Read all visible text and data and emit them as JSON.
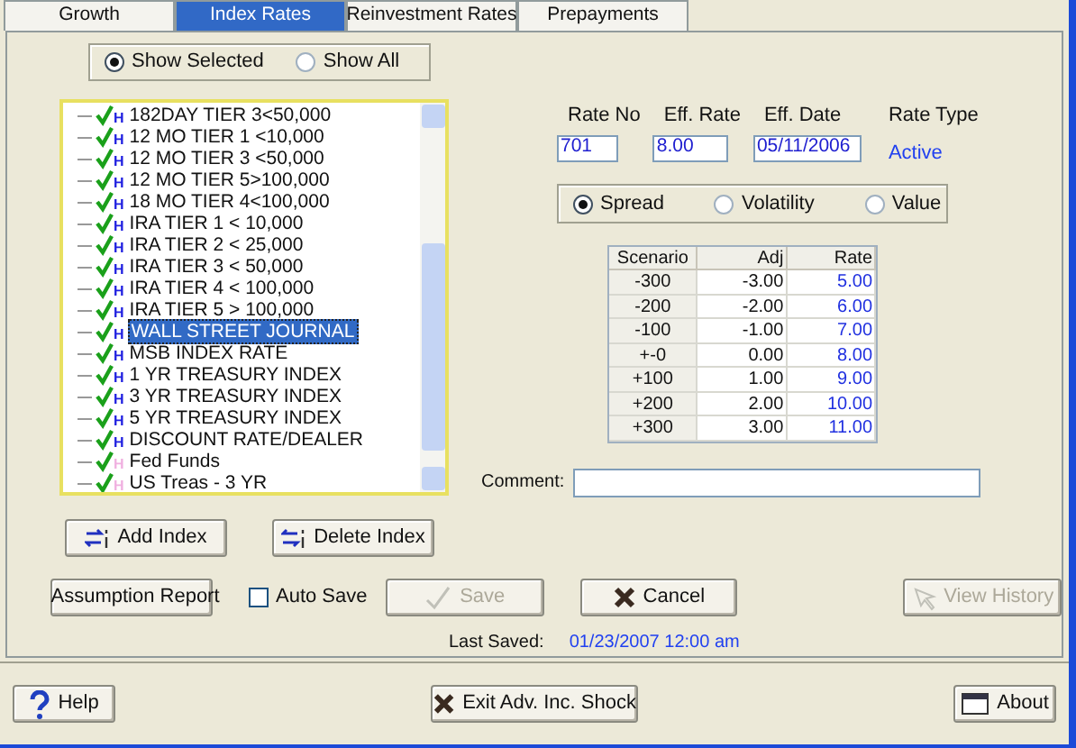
{
  "tabs": [
    {
      "label": "Growth",
      "selected": false
    },
    {
      "label": "Index Rates",
      "selected": true
    },
    {
      "label": "Reinvestment Rates",
      "selected": false
    },
    {
      "label": "Prepayments",
      "selected": false
    }
  ],
  "filter": [
    {
      "label": "Show Selected",
      "selected": true
    },
    {
      "label": "Show All",
      "selected": false
    }
  ],
  "index_list": [
    {
      "label": "182DAY TIER 3<50,000",
      "checked": true,
      "selected": false,
      "badge": "H",
      "color": "#2020e0"
    },
    {
      "label": "12 MO TIER 1 <10,000",
      "checked": true,
      "selected": false,
      "badge": "H",
      "color": "#2020e0"
    },
    {
      "label": "12 MO TIER 3 <50,000",
      "checked": true,
      "selected": false,
      "badge": "H",
      "color": "#2020e0"
    },
    {
      "label": "12 MO TIER 5>100,000",
      "checked": true,
      "selected": false,
      "badge": "H",
      "color": "#2020e0"
    },
    {
      "label": "18 MO TIER 4<100,000",
      "checked": true,
      "selected": false,
      "badge": "H",
      "color": "#2020e0"
    },
    {
      "label": "IRA TIER 1 < 10,000",
      "checked": true,
      "selected": false,
      "badge": "H",
      "color": "#2020e0"
    },
    {
      "label": "IRA TIER 2 < 25,000",
      "checked": true,
      "selected": false,
      "badge": "H",
      "color": "#2020e0"
    },
    {
      "label": "IRA TIER 3 < 50,000",
      "checked": true,
      "selected": false,
      "badge": "H",
      "color": "#2020e0"
    },
    {
      "label": "IRA TIER 4 < 100,000",
      "checked": true,
      "selected": false,
      "badge": "H",
      "color": "#2020e0"
    },
    {
      "label": "IRA TIER 5 > 100,000",
      "checked": true,
      "selected": false,
      "badge": "H",
      "color": "#2020e0"
    },
    {
      "label": "WALL STREET JOURNAL",
      "checked": true,
      "selected": true,
      "badge": "H",
      "color": "#2020e0"
    },
    {
      "label": "MSB INDEX RATE",
      "checked": true,
      "selected": false,
      "badge": "H",
      "color": "#2020e0"
    },
    {
      "label": "1 YR TREASURY INDEX",
      "checked": true,
      "selected": false,
      "badge": "H",
      "color": "#2020e0"
    },
    {
      "label": "3 YR TREASURY INDEX",
      "checked": true,
      "selected": false,
      "badge": "H",
      "color": "#2020e0"
    },
    {
      "label": "5 YR TREASURY INDEX",
      "checked": true,
      "selected": false,
      "badge": "H",
      "color": "#2020e0"
    },
    {
      "label": "DISCOUNT RATE/DEALER",
      "checked": true,
      "selected": false,
      "badge": "H",
      "color": "#2020e0"
    },
    {
      "label": "Fed Funds",
      "checked": true,
      "selected": false,
      "badge": "H",
      "color": "#f0b0e0"
    },
    {
      "label": "US Treas - 3 YR",
      "checked": true,
      "selected": false,
      "badge": "H",
      "color": "#f0b0e0"
    }
  ],
  "list_buttons": [
    {
      "label": "Add Index",
      "kind": "add"
    },
    {
      "label": "Delete Index",
      "kind": "delete"
    }
  ],
  "rate_fields": [
    {
      "label": "Rate No",
      "value": "701"
    },
    {
      "label": "Eff. Rate",
      "value": "8.00"
    },
    {
      "label": "Eff. Date",
      "value": "05/11/2006"
    }
  ],
  "rate_type": {
    "label": "Rate Type",
    "value": "Active"
  },
  "mode": [
    {
      "label": "Spread",
      "selected": true
    },
    {
      "label": "Volatility",
      "selected": false
    },
    {
      "label": "Value",
      "selected": false
    }
  ],
  "table": {
    "columns": [
      "Scenario",
      "Adj",
      "Rate"
    ],
    "rows": [
      [
        "-300",
        "-3.00",
        "5.00"
      ],
      [
        "-200",
        "-2.00",
        "6.00"
      ],
      [
        "-100",
        "-1.00",
        "7.00"
      ],
      [
        "+-0",
        "0.00",
        "8.00"
      ],
      [
        "+100",
        "1.00",
        "9.00"
      ],
      [
        "+200",
        "2.00",
        "10.00"
      ],
      [
        "+300",
        "3.00",
        "11.00"
      ]
    ]
  },
  "comment": {
    "label": "Comment:"
  },
  "actions": [
    {
      "label": "Assumption Report",
      "kind": "report",
      "disabled": false
    },
    {
      "label": "Auto Save",
      "kind": "checkbox",
      "checked": false
    },
    {
      "label": "Save",
      "kind": "save",
      "disabled": true
    },
    {
      "label": "Cancel",
      "kind": "cancel",
      "disabled": false
    },
    {
      "label": "View History",
      "kind": "history",
      "disabled": true
    }
  ],
  "last_saved": {
    "label": "Last Saved:",
    "value": "01/23/2007 12:00 am"
  },
  "footer": [
    {
      "label": "Help",
      "kind": "help"
    },
    {
      "label": "Exit Adv. Inc. Shock",
      "kind": "exit"
    },
    {
      "label": "About",
      "kind": "about"
    }
  ]
}
